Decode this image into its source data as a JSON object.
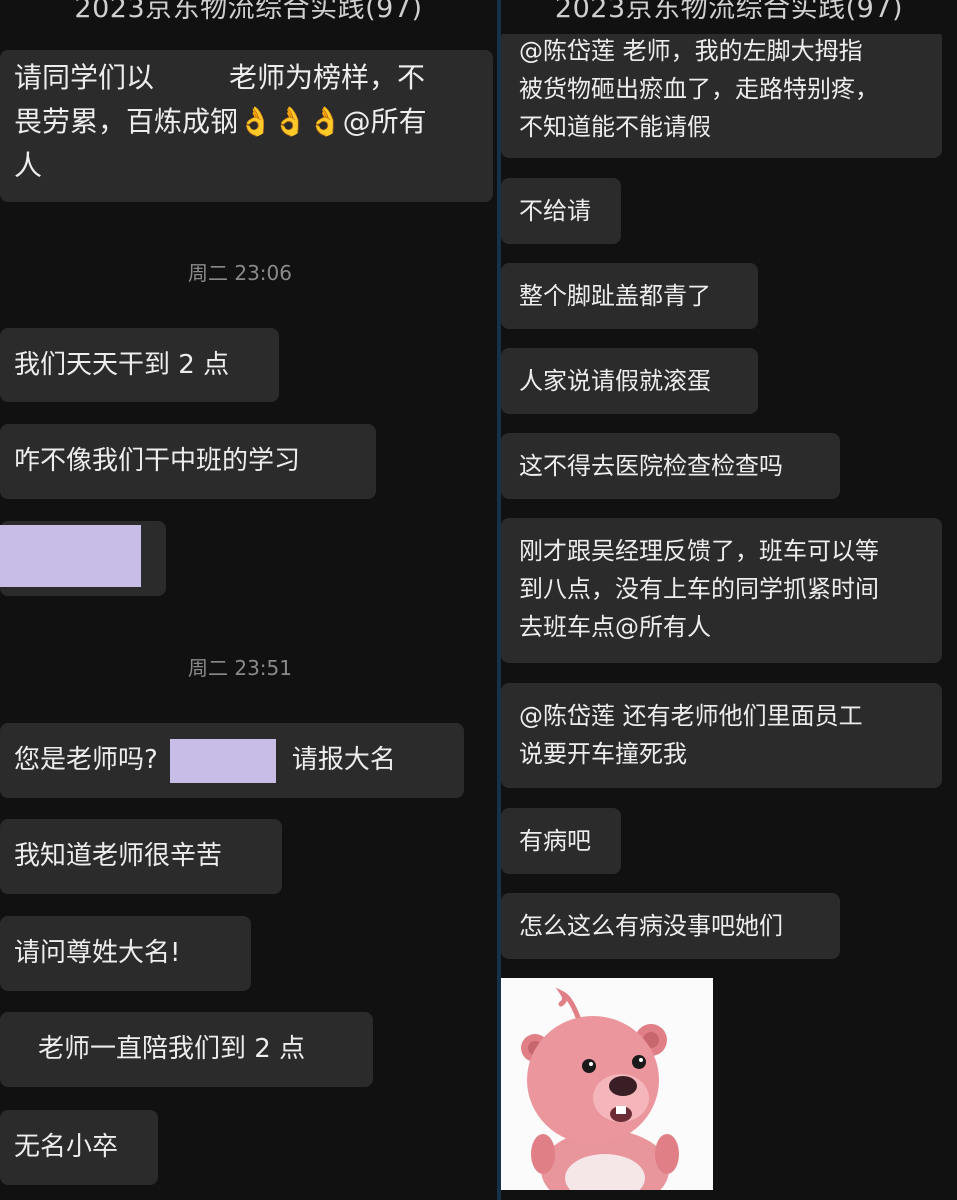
{
  "left": {
    "title": "2023京东物流综合实践(97)",
    "msg1": {
      "line1_pre": "请同学们以",
      "line1_post": "老师为榜样，不",
      "line2_text": "畏劳累，百炼成钢",
      "line2_emoji": "👌👌👌",
      "line2_end": "@所有",
      "line3": "人"
    },
    "time1": "周二 23:06",
    "msg2": "我们天天干到 2 点",
    "msg3": "咋不像我们干中班的学习",
    "time2": "周二 23:51",
    "msg4_pre": "您是老师吗?",
    "msg4_post": "请报大名",
    "msg5": "我知道老师很辛苦",
    "msg6": "请问尊姓大名!",
    "msg7": "老师一直陪我们到 2 点",
    "msg8": "无名小卒"
  },
  "right": {
    "title": "2023京东物流综合实践(97)",
    "msg1": {
      "line0": "@陈岱莲  老师，我的左脚大拇指",
      "line1": "被货物砸出瘀血了，走路特别疼，",
      "line2": "不知道能不能请假"
    },
    "msg2": "不给请",
    "msg3": "整个脚趾盖都青了",
    "msg4": "人家说请假就滚蛋",
    "msg5": "这不得去医院检查检查吗",
    "msg6": {
      "line1": "刚才跟吴经理反馈了，班车可以等",
      "line2": "到八点，没有上车的同学抓紧时间",
      "line3": "去班车点@所有人"
    },
    "msg7": {
      "line1": "@陈岱莲  还有老师他们里面员工",
      "line2": "说要开车撞死我"
    },
    "msg8": "有病吧",
    "msg9": "怎么这么有病没事吧她们",
    "sticker": "beaver-sticker"
  },
  "colors": {
    "background": "#111111",
    "bubble": "#2b2b2b",
    "redaction": "#c8bde6",
    "divider": "#16324a"
  }
}
